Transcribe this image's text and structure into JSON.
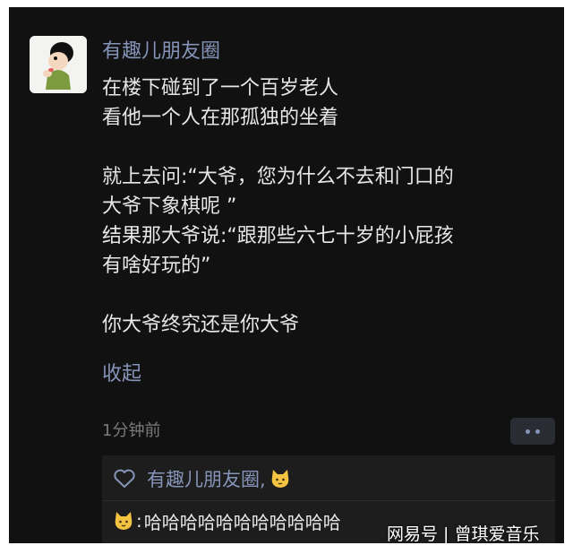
{
  "post": {
    "author": "有趣儿朋友圈",
    "lines": [
      "在楼下碰到了一个百岁老人",
      "看他一个人在那孤独的坐着",
      "",
      "就上去问:“大爷，您为什么不去和门口的",
      "大爷下象棋呢 ”",
      "结果那大爷说:“跟那些六七十岁的小屁孩",
      "有啥好玩的”",
      "",
      "你大爷终究还是你大爷"
    ],
    "collapse_label": "收起",
    "time": "1分钟前"
  },
  "likes": {
    "names": "有趣儿朋友圈,"
  },
  "comment": {
    "separator": ":",
    "text": "哈哈哈哈哈哈哈哈哈哈哈"
  },
  "watermark": "网易号 | 曾琪爱音乐",
  "colors": {
    "background": "#111111",
    "link": "#8594b8",
    "text": "#e7e7e7",
    "comment_bg": "#1d1d1d",
    "emoji_yellow": "#f3c341"
  },
  "icons": {
    "avatar": "cartoon-avatar-icon",
    "like": "heart-icon",
    "more": "more-dots-icon",
    "emoji": "cat-face-icon"
  }
}
